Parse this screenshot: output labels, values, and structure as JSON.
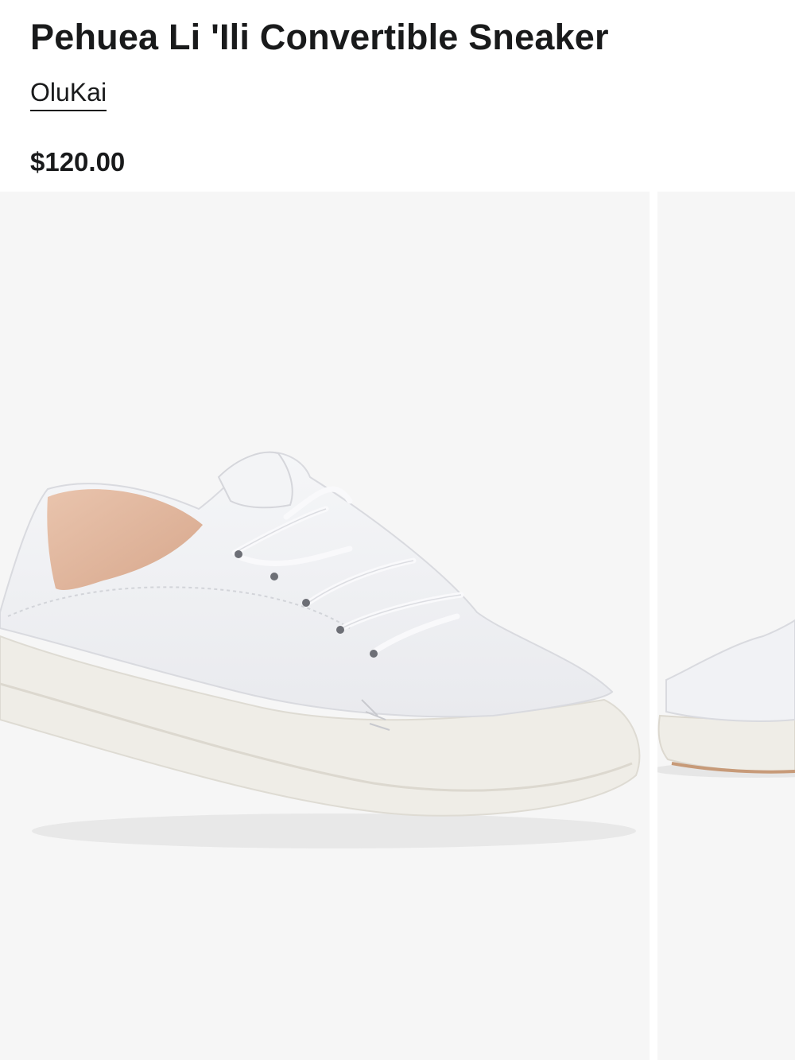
{
  "product": {
    "title": "Pehuea Li 'Ili Convertible Sneaker",
    "brand": "OluKai",
    "price": "$120.00"
  },
  "gallery": {
    "images": [
      {
        "name": "product-image-1",
        "subject": "white leather lace-up sneaker, three-quarter side view"
      },
      {
        "name": "product-image-2",
        "subject": "white sneaker with collapsed heel, partial view"
      }
    ]
  },
  "colors": {
    "text": "#191a1b",
    "image_background": "#f6f6f6"
  }
}
